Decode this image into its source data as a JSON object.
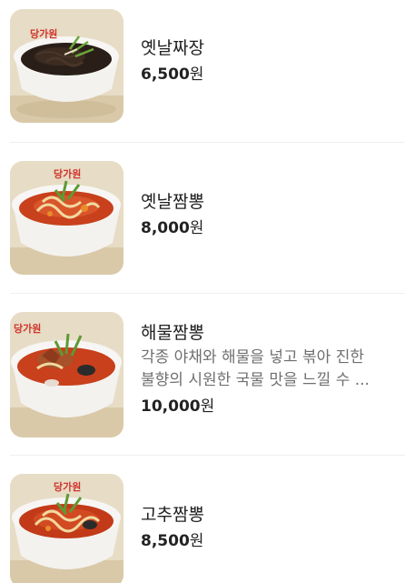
{
  "currency_unit": "원",
  "menu": [
    {
      "name": "옛날짜장",
      "price": "6,500",
      "image": "black-bean-noodles-photo",
      "bowl_text": "당가원"
    },
    {
      "name": "옛날짬뽕",
      "price": "8,000",
      "image": "spicy-seafood-noodle-soup-photo",
      "bowl_text": "당가원"
    },
    {
      "name": "해물짬뽕",
      "description_line1": "각종 야채와 해물을 넣고 볶아 진한",
      "description_line2": "불향의 시원한 국물 맛을 느낄 수 ...",
      "price": "10,000",
      "image": "seafood-noodle-soup-photo",
      "bowl_text": "당가원"
    },
    {
      "name": "고추짬뽕",
      "price": "8,500",
      "image": "chili-seafood-noodle-soup-photo",
      "bowl_text": "당가원"
    }
  ],
  "colors": {
    "broth_red": "#c8401c",
    "bean_sauce": "#2a1f18",
    "bowl_white": "#f4f2ef",
    "stamp_red": "#d0342c",
    "background_beige": "#e7dcc5"
  }
}
